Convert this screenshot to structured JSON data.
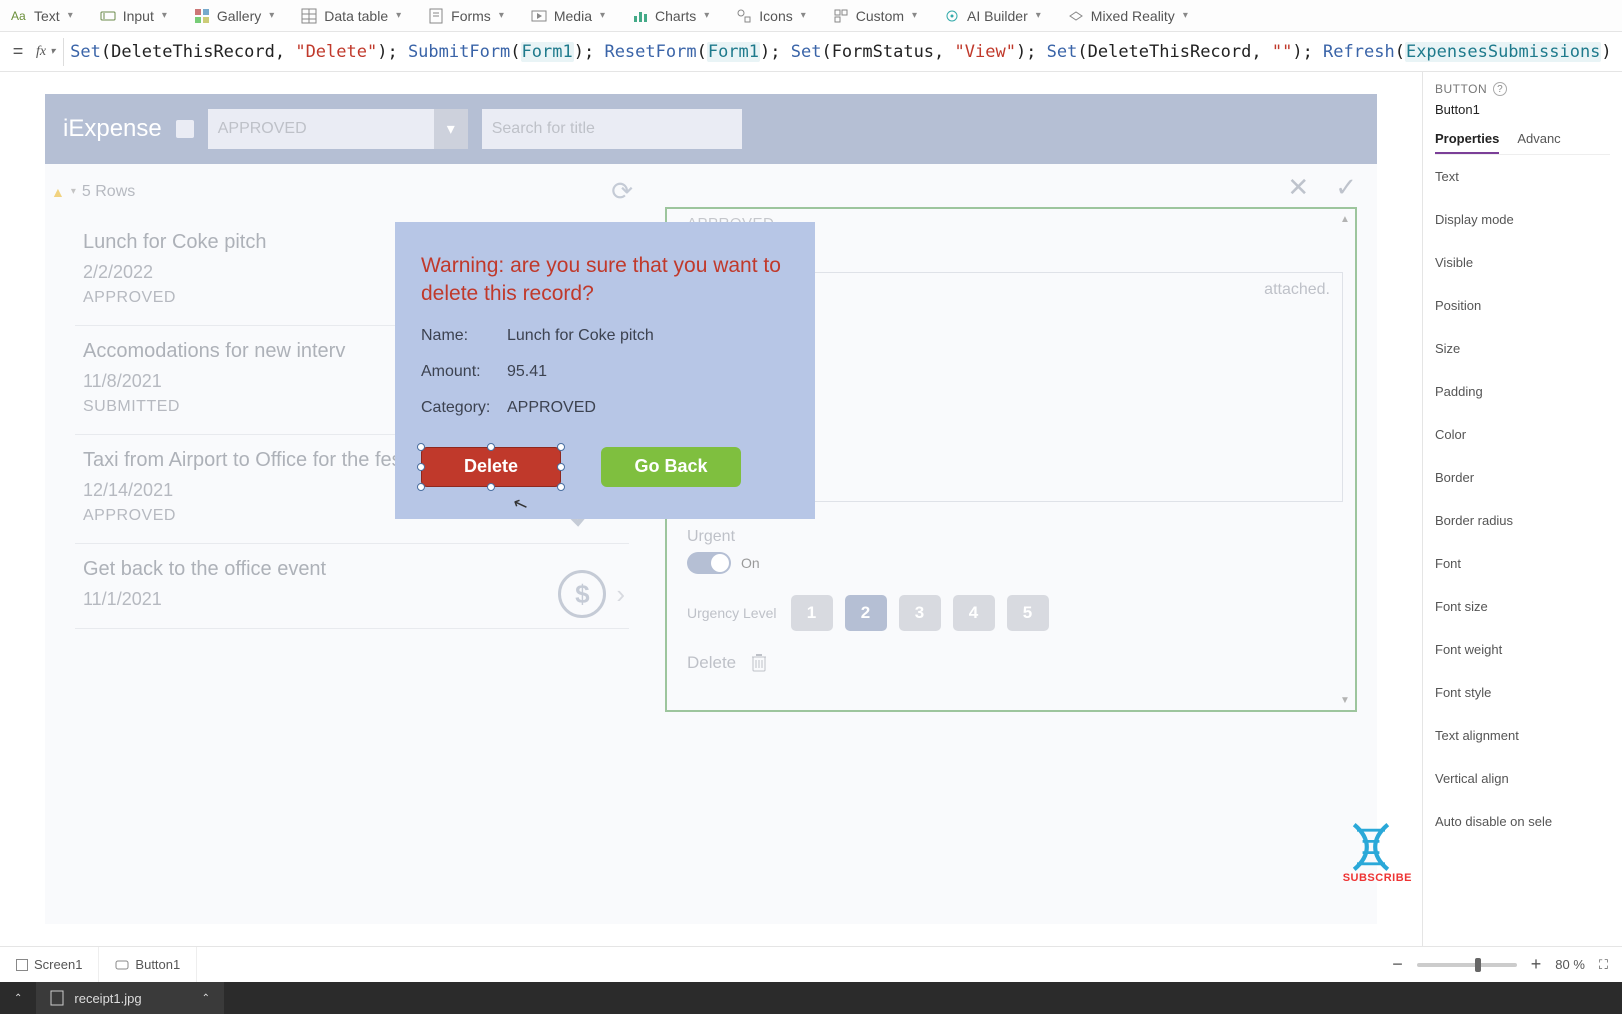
{
  "ribbon": {
    "items": [
      {
        "label": "Text",
        "icon": "text"
      },
      {
        "label": "Input",
        "icon": "input"
      },
      {
        "label": "Gallery",
        "icon": "gallery"
      },
      {
        "label": "Data table",
        "icon": "datatable"
      },
      {
        "label": "Forms",
        "icon": "forms"
      },
      {
        "label": "Media",
        "icon": "media"
      },
      {
        "label": "Charts",
        "icon": "charts"
      },
      {
        "label": "Icons",
        "icon": "icons"
      },
      {
        "label": "Custom",
        "icon": "custom"
      },
      {
        "label": "AI Builder",
        "icon": "ai"
      },
      {
        "label": "Mixed Reality",
        "icon": "mr"
      }
    ]
  },
  "formula_bar": {
    "raw": "Set(DeleteThisRecord, \"Delete\"); SubmitForm(Form1); ResetForm(Form1); Set(FormStatus, \"View\"); Set(DeleteThisRecord, \"\"); Refresh(ExpensesSubmissions)",
    "tokens": [
      {
        "t": "Set",
        "c": "kw"
      },
      {
        "t": "(DeleteThisRecord, ",
        "c": ""
      },
      {
        "t": "\"Delete\"",
        "c": "str"
      },
      {
        "t": "); ",
        "c": ""
      },
      {
        "t": "SubmitForm",
        "c": "kw"
      },
      {
        "t": "(",
        "c": ""
      },
      {
        "t": "Form1",
        "c": "id"
      },
      {
        "t": "); ",
        "c": ""
      },
      {
        "t": "ResetForm",
        "c": "kw"
      },
      {
        "t": "(",
        "c": ""
      },
      {
        "t": "Form1",
        "c": "id"
      },
      {
        "t": "); ",
        "c": ""
      },
      {
        "t": "Set",
        "c": "kw"
      },
      {
        "t": "(FormStatus, ",
        "c": ""
      },
      {
        "t": "\"View\"",
        "c": "str"
      },
      {
        "t": "); ",
        "c": ""
      },
      {
        "t": "Set",
        "c": "kw"
      },
      {
        "t": "(DeleteThisRecord, ",
        "c": ""
      },
      {
        "t": "\"\"",
        "c": "str"
      },
      {
        "t": "); ",
        "c": ""
      },
      {
        "t": "Refresh",
        "c": "kw"
      },
      {
        "t": "(",
        "c": ""
      },
      {
        "t": "ExpensesSubmissions",
        "c": "id"
      },
      {
        "t": ")",
        "c": ""
      }
    ]
  },
  "app": {
    "title": "iExpense",
    "dropdown_value": "APPROVED",
    "search_placeholder": "Search for title",
    "rowcount_label": "5 Rows",
    "list": [
      {
        "title": "Lunch for Coke pitch",
        "date": "2/2/2022",
        "status": "APPROVED",
        "icons": []
      },
      {
        "title": "Accomodations for new interv",
        "date": "11/8/2021",
        "status": "SUBMITTED",
        "icons": []
      },
      {
        "title": "Taxi from Airport to Office for the festival",
        "date": "12/14/2021",
        "status": "APPROVED",
        "icons": [
          "check",
          "chev"
        ]
      },
      {
        "title": "Get back to the office event",
        "date": "11/1/2021",
        "status": "",
        "icons": [
          "dollar",
          "chev"
        ]
      }
    ],
    "form": {
      "status": "APPROVED",
      "attached_text": "attached.",
      "urgent_label": "Urgent",
      "urgent_on_label": "On",
      "urgency_label": "Urgency Level",
      "urgency_levels": [
        "1",
        "2",
        "3",
        "4",
        "5"
      ],
      "urgency_active_index": 1,
      "delete_label": "Delete"
    }
  },
  "modal": {
    "title": "Warning: are you sure that you want to delete this record?",
    "rows": [
      {
        "label": "Name:",
        "value": "Lunch for Coke pitch"
      },
      {
        "label": "Amount:",
        "value": "95.41"
      },
      {
        "label": "Category:",
        "value": "APPROVED"
      }
    ],
    "delete_label": "Delete",
    "goback_label": "Go Back"
  },
  "props": {
    "type_label": "BUTTON",
    "name": "Button1",
    "tabs": [
      "Properties",
      "Advanc"
    ],
    "items": [
      "Text",
      "Display mode",
      "Visible",
      "Position",
      "Size",
      "Padding",
      "Color",
      "Border",
      "Border radius",
      "Font",
      "Font size",
      "Font weight",
      "Font style",
      "Text alignment",
      "Vertical align",
      "Auto disable on sele"
    ]
  },
  "breadcrumb": {
    "screen": "Screen1",
    "control": "Button1"
  },
  "zoom": {
    "value": "80",
    "unit": "%"
  },
  "taskbar": {
    "file": "receipt1.jpg"
  },
  "watermark": {
    "text": "SUBSCRIBE"
  }
}
